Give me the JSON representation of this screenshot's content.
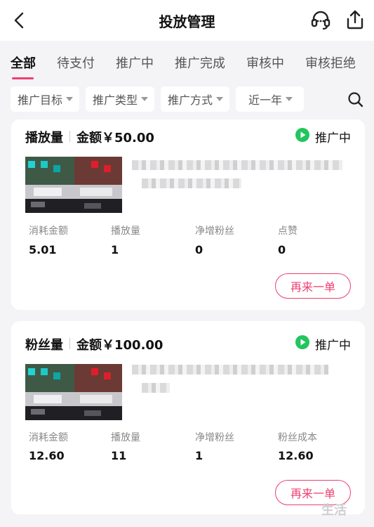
{
  "header": {
    "title": "投放管理",
    "back_icon": "chevron-left-icon",
    "service_icon": "headset-icon",
    "share_icon": "share-icon"
  },
  "tabs": [
    {
      "label": "全部",
      "active": true
    },
    {
      "label": "待支付",
      "active": false
    },
    {
      "label": "推广中",
      "active": false
    },
    {
      "label": "推广完成",
      "active": false
    },
    {
      "label": "审核中",
      "active": false
    },
    {
      "label": "审核拒绝",
      "active": false
    }
  ],
  "filters": [
    {
      "label": "推广目标"
    },
    {
      "label": "推广类型"
    },
    {
      "label": "推广方式"
    },
    {
      "label": "近一年"
    }
  ],
  "colors": {
    "accent": "#ee3f70",
    "status_green": "#22c55e"
  },
  "orders": [
    {
      "type_label": "播放量",
      "amount_label": "金额￥50.00",
      "status": "推广中",
      "metrics": [
        {
          "label": "消耗金额",
          "value": "5.01"
        },
        {
          "label": "播放量",
          "value": "1"
        },
        {
          "label": "净增粉丝",
          "value": "0"
        },
        {
          "label": "点赞",
          "value": "0"
        }
      ],
      "action_label": "再来一单"
    },
    {
      "type_label": "粉丝量",
      "amount_label": "金额￥100.00",
      "status": "推广中",
      "metrics": [
        {
          "label": "消耗金额",
          "value": "12.60"
        },
        {
          "label": "播放量",
          "value": "11"
        },
        {
          "label": "净增粉丝",
          "value": "1"
        },
        {
          "label": "粉丝成本",
          "value": "12.60"
        }
      ],
      "action_label": "再来一单"
    }
  ],
  "watermark": "生活"
}
